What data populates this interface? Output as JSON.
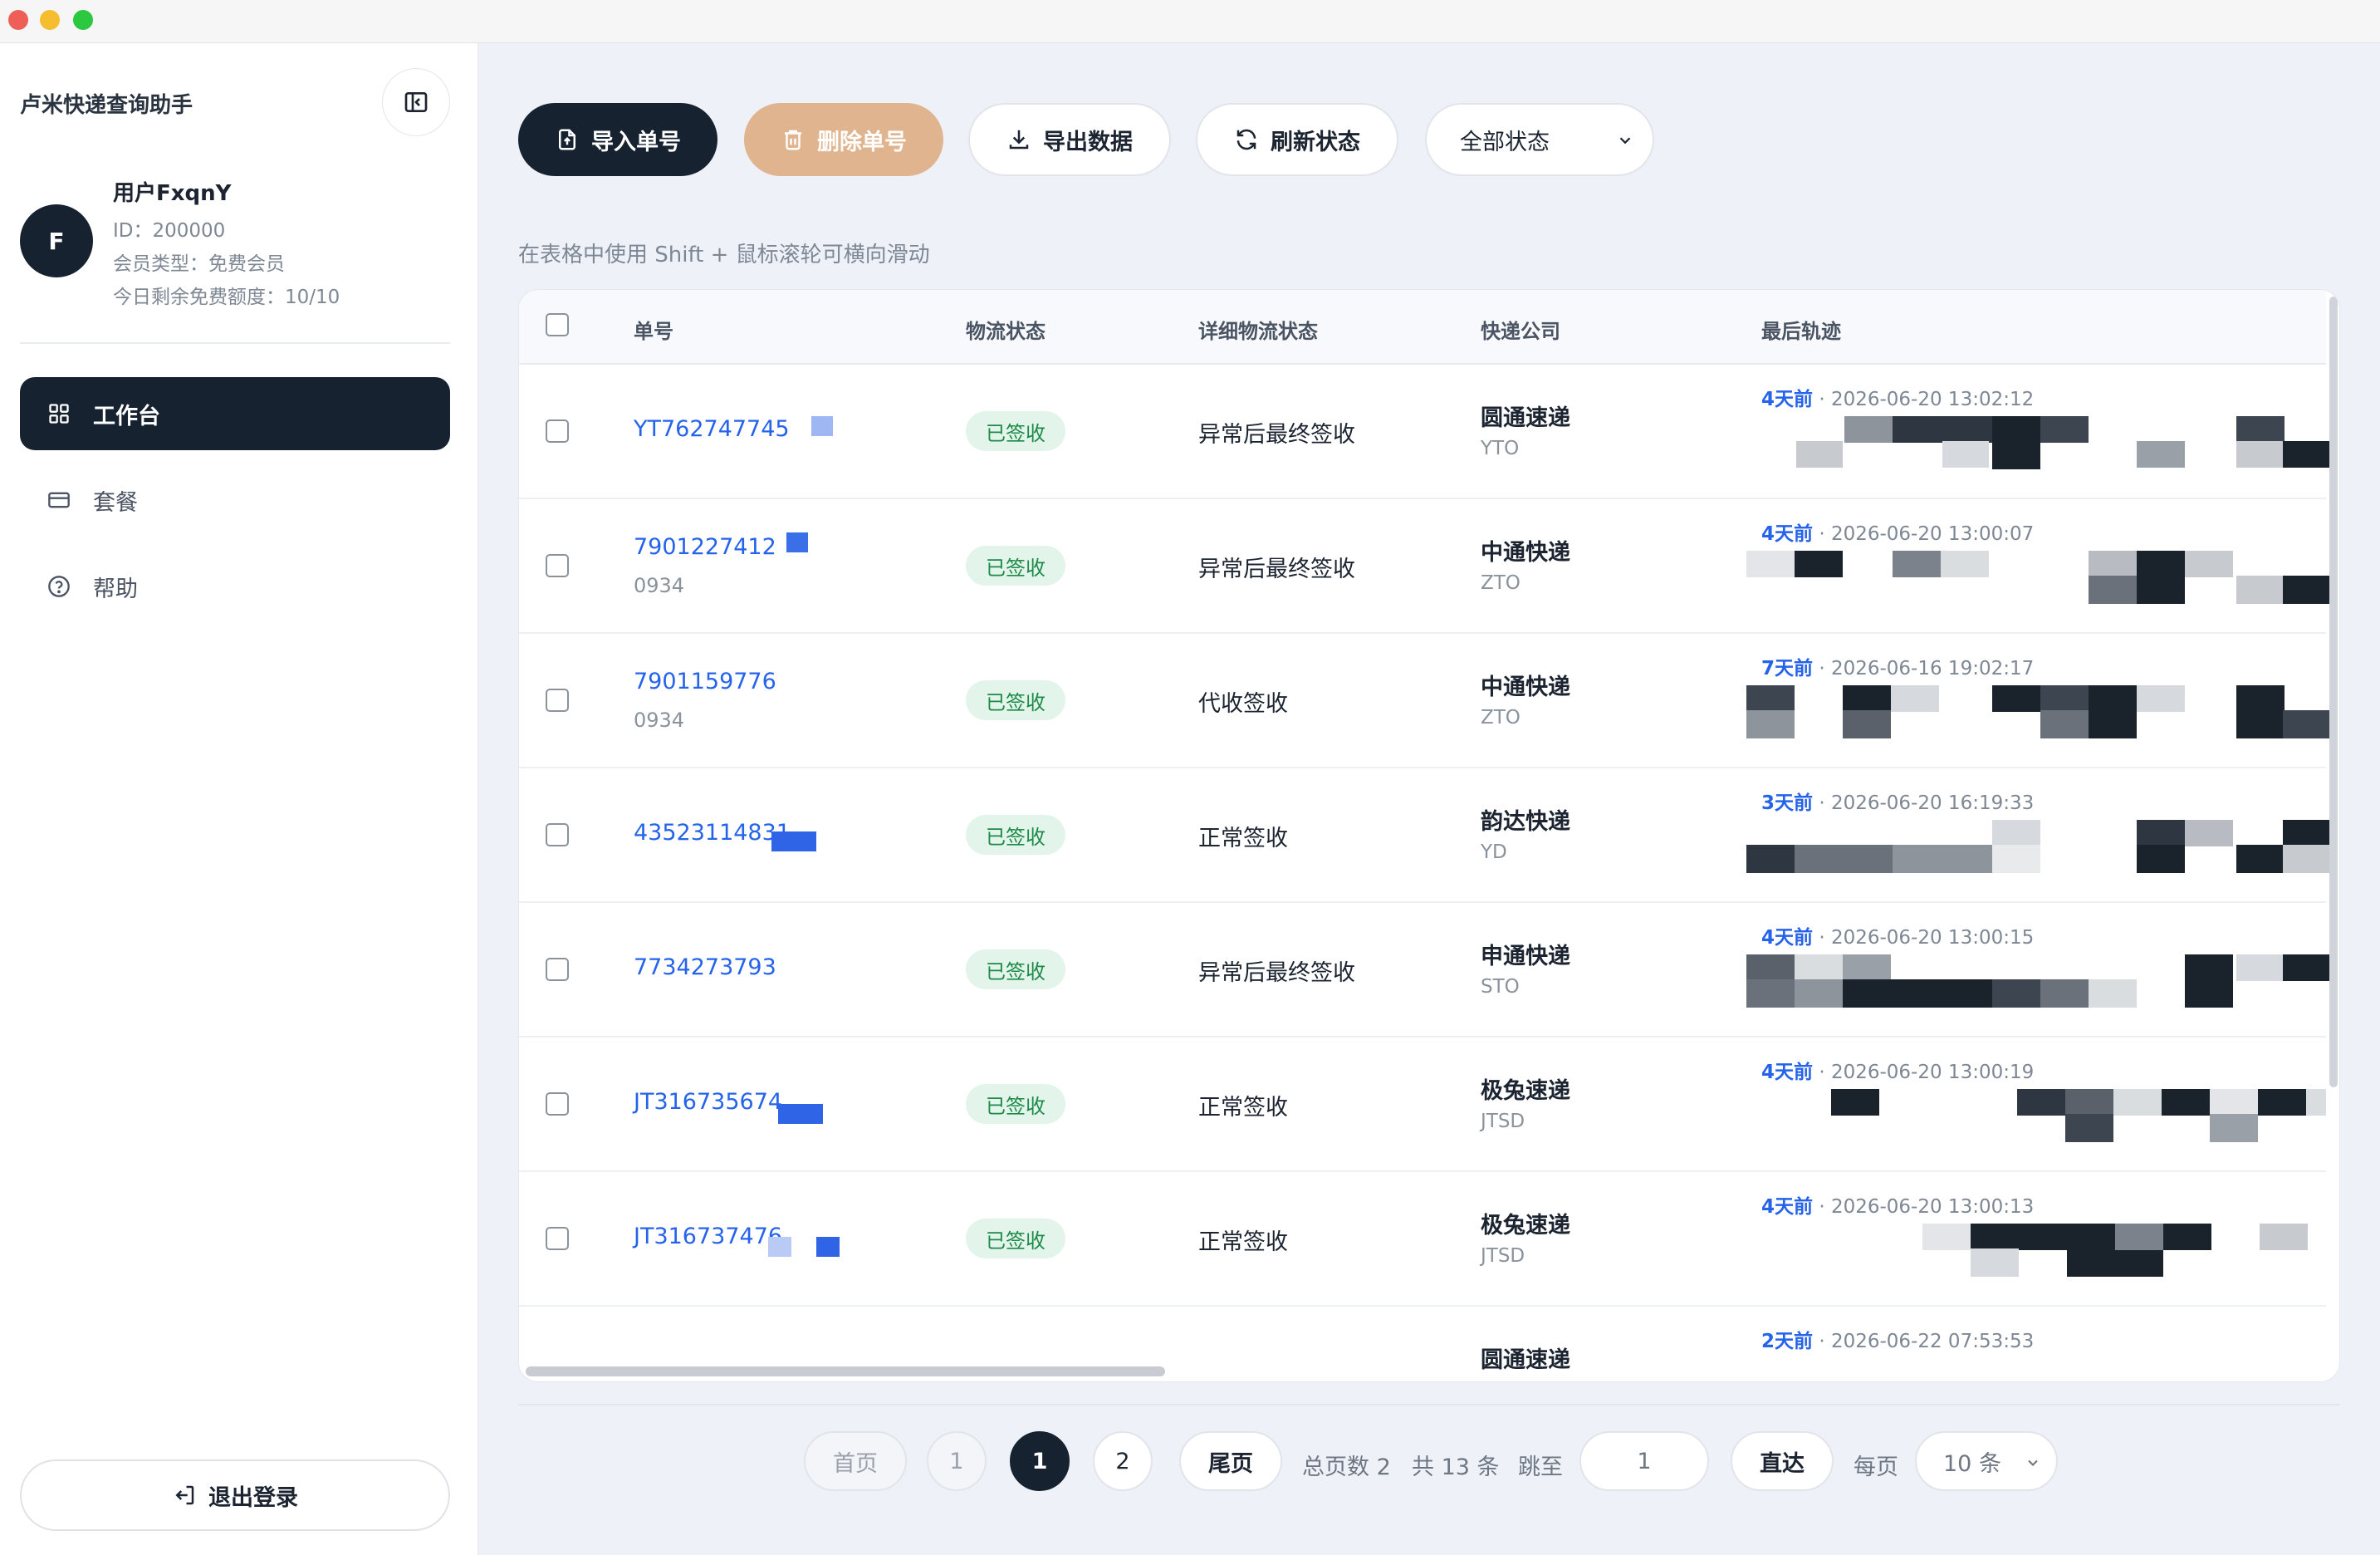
{
  "window": {
    "controls": [
      "close",
      "minimize",
      "zoom"
    ]
  },
  "sidebar": {
    "app_title": "卢米快递查询助手",
    "user": {
      "avatar_letter": "F",
      "name": "用户FxqnY",
      "id_line": "ID：200000",
      "member_line": "会员类型：免费会员",
      "quota_line": "今日剩余免费额度：10/10"
    },
    "nav": [
      {
        "label": "工作台",
        "icon": "dashboard-grid-icon",
        "active": true
      },
      {
        "label": "套餐",
        "icon": "card-icon",
        "active": false
      },
      {
        "label": "帮助",
        "icon": "help-circle-icon",
        "active": false
      }
    ],
    "logout_label": "退出登录"
  },
  "toolbar": {
    "import_label": "导入单号",
    "delete_label": "删除单号",
    "export_label": "导出数据",
    "refresh_label": "刷新状态",
    "status_filter": "全部状态"
  },
  "hint": "在表格中使用 Shift + 鼠标滚轮可横向滑动",
  "table": {
    "headers": [
      "单号",
      "物流状态",
      "详细物流状态",
      "快递公司",
      "最后轨迹"
    ],
    "rows": [
      {
        "tracking": "YT762747745",
        "tracking_sub": "",
        "status": "已签收",
        "detail": "异常后最终签收",
        "carrier": "圆通速递",
        "carrier_code": "YTO",
        "ago": "4天前",
        "time": "2026-06-20 13:02:12"
      },
      {
        "tracking": "7901227412",
        "tracking_sub": "0934",
        "status": "已签收",
        "detail": "异常后最终签收",
        "carrier": "中通快递",
        "carrier_code": "ZTO",
        "ago": "4天前",
        "time": "2026-06-20 13:00:07"
      },
      {
        "tracking": "7901159776",
        "tracking_sub": "0934",
        "status": "已签收",
        "detail": "代收签收",
        "carrier": "中通快递",
        "carrier_code": "ZTO",
        "ago": "7天前",
        "time": "2026-06-16 19:02:17"
      },
      {
        "tracking": "43523114831",
        "tracking_sub": "",
        "status": "已签收",
        "detail": "正常签收",
        "carrier": "韵达快递",
        "carrier_code": "YD",
        "ago": "3天前",
        "time": "2026-06-20 16:19:33"
      },
      {
        "tracking": "7734273793",
        "tracking_sub": "",
        "status": "已签收",
        "detail": "异常后最终签收",
        "carrier": "申通快递",
        "carrier_code": "STO",
        "ago": "4天前",
        "time": "2026-06-20 13:00:15"
      },
      {
        "tracking": "JT316735674",
        "tracking_sub": "",
        "status": "已签收",
        "detail": "正常签收",
        "carrier": "极兔速递",
        "carrier_code": "JTSD",
        "ago": "4天前",
        "time": "2026-06-20 13:00:19"
      },
      {
        "tracking": "JT316737476",
        "tracking_sub": "",
        "status": "已签收",
        "detail": "正常签收",
        "carrier": "极兔速递",
        "carrier_code": "JTSD",
        "ago": "4天前",
        "time": "2026-06-20 13:00:13"
      },
      {
        "tracking": "",
        "tracking_sub": "",
        "status": "",
        "detail": "",
        "carrier": "圆通速递",
        "carrier_code": "",
        "ago": "2天前",
        "time": "2026-06-22 07:53:53"
      }
    ]
  },
  "pagination": {
    "first": "首页",
    "page_1_muted": "1",
    "page_current": "1",
    "page_2": "2",
    "last": "尾页",
    "total_pages": "总页数 2",
    "total_items": "共 13 条",
    "jump_label": "跳至",
    "jump_value": "1",
    "go_label": "直达",
    "per_page_label": "每页",
    "per_page_value": "10 条"
  },
  "colors": {
    "dark": "#172230",
    "accent_blue": "#2563eb",
    "delete_orange": "#dfb48f",
    "success_green": "#1e8a4a",
    "success_bg": "#e3f5ea"
  }
}
